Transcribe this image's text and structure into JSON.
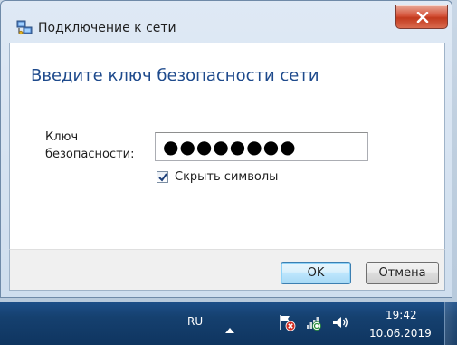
{
  "window": {
    "title": "Подключение к сети"
  },
  "dialog": {
    "heading": "Введите ключ безопасности сети",
    "key_label_line1": "Ключ",
    "key_label_line2": "безопасности:",
    "key_value": "●●●●●●●●",
    "hide_chars_label": "Скрыть символы",
    "hide_chars_checked": true
  },
  "buttons": {
    "ok": "OK",
    "cancel": "Отмена"
  },
  "taskbar": {
    "language": "RU",
    "time": "19:42",
    "date": "10.06.2019"
  },
  "colors": {
    "heading": "#1e4a8c",
    "taskbar": "#15406f",
    "close_button": "#c23a1e"
  }
}
